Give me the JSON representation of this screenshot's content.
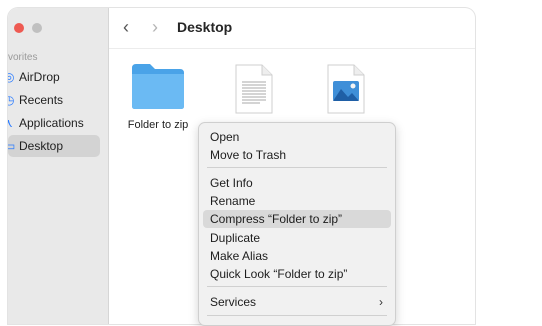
{
  "sidebar": {
    "section_label": "vorites",
    "items": [
      {
        "label": "AirDrop",
        "icon": "airdrop-icon",
        "glyph": "◎"
      },
      {
        "label": "Recents",
        "icon": "clock-icon",
        "glyph": "◷"
      },
      {
        "label": "Applications",
        "icon": "applications-icon",
        "glyph": "⋏"
      },
      {
        "label": "Desktop",
        "icon": "desktop-icon",
        "glyph": "▭"
      }
    ]
  },
  "toolbar": {
    "title": "Desktop",
    "back_glyph": "‹",
    "forward_glyph": "›"
  },
  "files": [
    {
      "label": "Folder to zip",
      "icon": "folder-icon"
    },
    {
      "label": "",
      "icon": "text-document-icon"
    },
    {
      "label": "",
      "icon": "image-file-icon"
    }
  ],
  "context_menu": {
    "groups": [
      [
        "Open",
        "Move to Trash"
      ],
      [
        "Get Info",
        "Rename",
        "Compress “Folder to zip”",
        "Duplicate",
        "Make Alias",
        "Quick Look “Folder to zip”"
      ],
      [
        "Services"
      ]
    ],
    "highlighted": "Compress “Folder to zip”",
    "submenu_glyph": "›"
  },
  "colors": {
    "folder": "#5aaef0",
    "accent": "#2a7bff",
    "close_button": "#ee5a52"
  }
}
